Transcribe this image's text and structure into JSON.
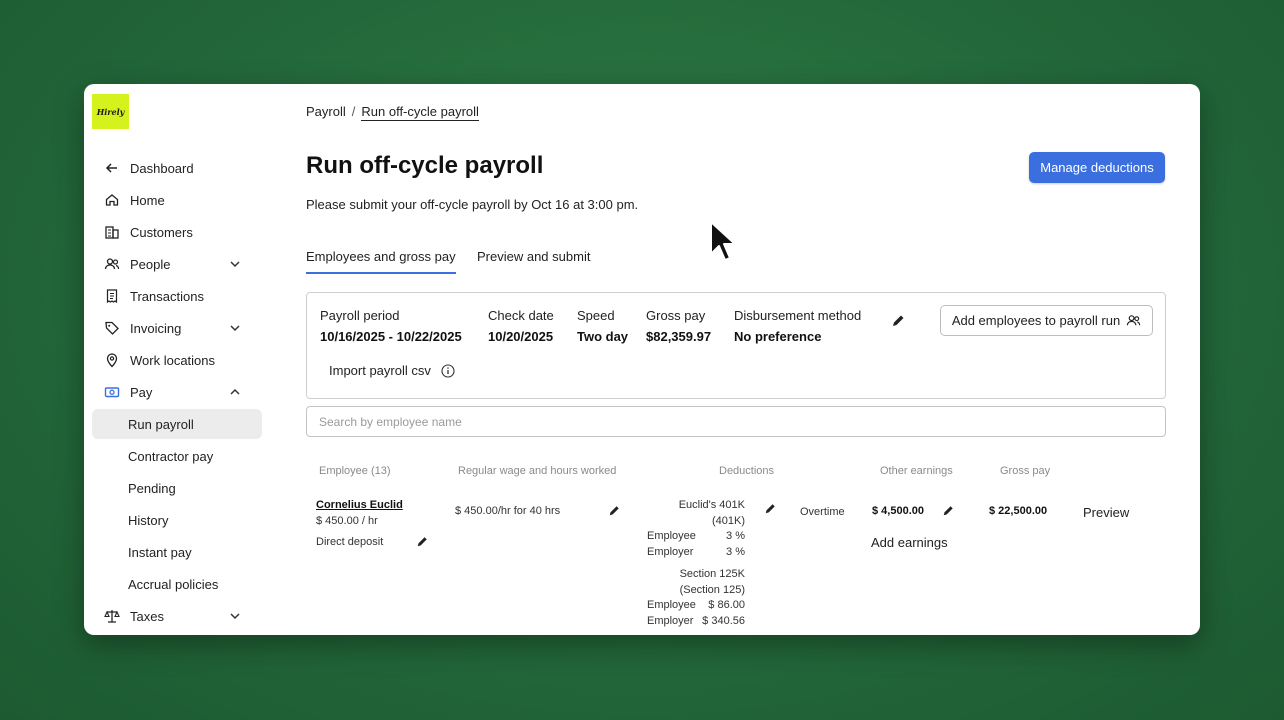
{
  "app": {
    "logo_text": "Hirely",
    "brand_color": "#d6f21c",
    "accent_color": "#3b6fe0"
  },
  "sidebar": {
    "items": [
      {
        "label": "Dashboard",
        "icon": "arrow-left-icon"
      },
      {
        "label": "Home",
        "icon": "home-icon"
      },
      {
        "label": "Customers",
        "icon": "building-icon"
      },
      {
        "label": "People",
        "icon": "people-icon",
        "expandable": true
      },
      {
        "label": "Transactions",
        "icon": "receipt-icon"
      },
      {
        "label": "Invoicing",
        "icon": "tag-icon",
        "expandable": true
      },
      {
        "label": "Work locations",
        "icon": "location-pin-icon"
      },
      {
        "label": "Pay",
        "icon": "money-icon",
        "expanded": true
      },
      {
        "label": "Run payroll",
        "active": true
      },
      {
        "label": "Contractor pay"
      },
      {
        "label": "Pending"
      },
      {
        "label": "History"
      },
      {
        "label": "Instant pay"
      },
      {
        "label": "Accrual policies"
      },
      {
        "label": "Taxes",
        "icon": "scale-icon",
        "expandable": true
      }
    ]
  },
  "breadcrumb": {
    "parent": "Payroll",
    "separator": "/",
    "current": "Run off-cycle payroll"
  },
  "page": {
    "title": "Run off-cycle payroll",
    "subtitle": "Please submit your off-cycle payroll by Oct 16 at 3:00 pm.",
    "manage_button": "Manage deductions"
  },
  "tabs": [
    {
      "label": "Employees and gross pay",
      "active": true
    },
    {
      "label": "Preview and submit",
      "active": false
    }
  ],
  "summary": {
    "payroll_period_label": "Payroll period",
    "payroll_period_value": "10/16/2025 - 10/22/2025",
    "check_date_label": "Check date",
    "check_date_value": "10/20/2025",
    "speed_label": "Speed",
    "speed_value": "Two day",
    "gross_pay_label": "Gross pay",
    "gross_pay_value": "$82,359.97",
    "disbursement_label": "Disbursement method",
    "disbursement_value": "No preference",
    "add_employees_button": "Add employees to payroll run",
    "import_label": "Import payroll csv"
  },
  "search": {
    "placeholder": "Search by employee name"
  },
  "table": {
    "headers": {
      "employee": "Employee (13)",
      "wage": "Regular wage and hours worked",
      "deductions": "Deductions",
      "other_earnings": "Other earnings",
      "gross_pay": "Gross pay"
    },
    "rows": [
      {
        "name": "Cornelius Euclid",
        "rate": "$ 450.00 / hr",
        "payment_method": "Direct deposit",
        "wage_hours": "$ 450.00/hr for 40 hrs",
        "deduction_1_title_a": "Euclid's 401K",
        "deduction_1_title_b": "(401K)",
        "deduction_1_employee_label": "Employee",
        "deduction_1_employee_value": "3 %",
        "deduction_1_employer_label": "Employer",
        "deduction_1_employer_value": "3 %",
        "deduction_2_title_a": "Section 125K",
        "deduction_2_title_b": "(Section 125)",
        "deduction_2_employee_label": "Employee",
        "deduction_2_employee_value": "$ 86.00",
        "deduction_2_employer_label": "Employer",
        "deduction_2_employer_value": "$ 340.56",
        "earning_type": "Overtime",
        "earning_amount": "$ 4,500.00",
        "add_earnings": "Add earnings",
        "gross_pay": "$ 22,500.00",
        "preview": "Preview"
      }
    ]
  }
}
